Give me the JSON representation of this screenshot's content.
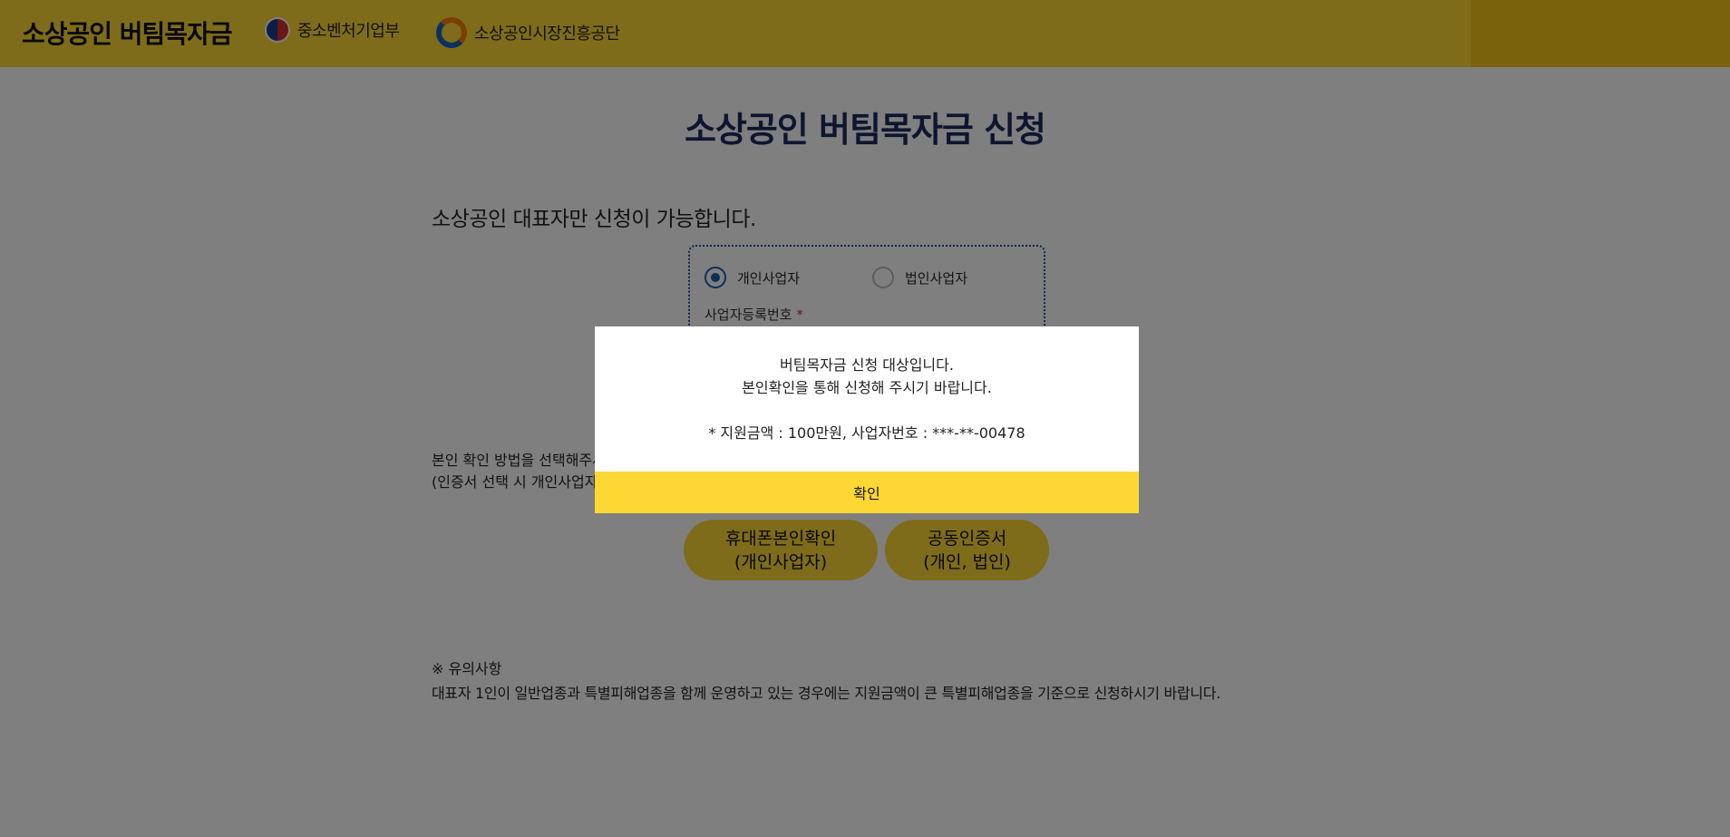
{
  "header": {
    "brand": "소상공인 버팀목자금",
    "org1": "중소벤처기업부",
    "org2": "소상공인시장진흥공단",
    "color": "#fdd835"
  },
  "main": {
    "title": "소상공인 버팀목자금 신청",
    "notice": "소상공인 대표자만 신청이 가능합니다.",
    "radios": [
      {
        "label": "개인사업자",
        "checked": true
      },
      {
        "label": "법인사업자",
        "checked": false
      }
    ],
    "business_number_label": "사업자등록번호",
    "required_mark": "*",
    "verify_line1": "본인 확인 방법을 선택해주세요",
    "verify_line2": "(인증서 선택 시 개인사업자는",
    "btn_phone_line1": "휴대폰본인확인",
    "btn_phone_line2": "(개인사업자)",
    "btn_cert_line1": "공동인증서",
    "btn_cert_line2": "(개인, 법인)",
    "caution_title": "※ 유의사항",
    "caution_body": "대표자 1인이 일반업종과 특별피해업종을 함께 운영하고 있는 경우에는 지원금액이 큰 특별피해업종을 기준으로 신청하시기 바랍니다."
  },
  "modal": {
    "line1": "버팀목자금 신청 대상입니다.",
    "line2": "본인확인을 통해 신청해 주시기 바랍니다.",
    "line3": "* 지원금액 : 100만원, 사업자번호 : ***-**-00478",
    "confirm_label": "확인"
  }
}
